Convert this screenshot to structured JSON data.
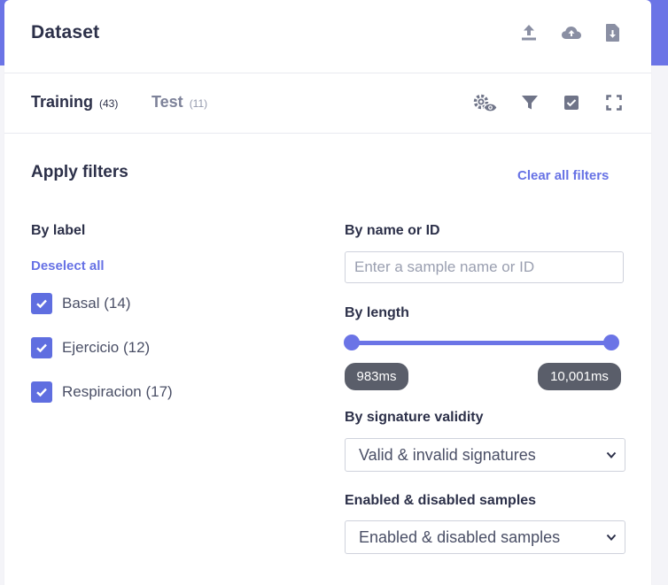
{
  "header": {
    "title": "Dataset",
    "icons": [
      "upload-icon",
      "cloud-upload-icon",
      "file-download-icon"
    ]
  },
  "tabs": [
    {
      "label": "Training",
      "count": "(43)",
      "active": true
    },
    {
      "label": "Test",
      "count": "(11)",
      "active": false
    }
  ],
  "toolbar": {
    "icons": [
      "settings-eye-icon",
      "filter-icon",
      "check-square-icon",
      "expand-icon"
    ]
  },
  "filters": {
    "title": "Apply filters",
    "clear_all": "Clear all filters",
    "by_label": {
      "heading": "By label",
      "deselect_all": "Deselect all",
      "items": [
        {
          "label": "Basal (14)",
          "checked": true
        },
        {
          "label": "Ejercicio (12)",
          "checked": true
        },
        {
          "label": "Respiracion (17)",
          "checked": true
        }
      ]
    },
    "by_name": {
      "heading": "By name or ID",
      "placeholder": "Enter a sample name or ID",
      "value": ""
    },
    "by_length": {
      "heading": "By length",
      "min_label": "983ms",
      "max_label": "10,001ms"
    },
    "by_signature": {
      "heading": "By signature validity",
      "selected": "Valid & invalid signatures"
    },
    "enabled": {
      "heading": "Enabled & disabled samples",
      "selected": "Enabled & disabled samples"
    }
  },
  "colors": {
    "accent": "#6b74e6",
    "checkbox": "#5f6ee0",
    "link": "#6772e5",
    "pill": "#5a5e6a"
  }
}
